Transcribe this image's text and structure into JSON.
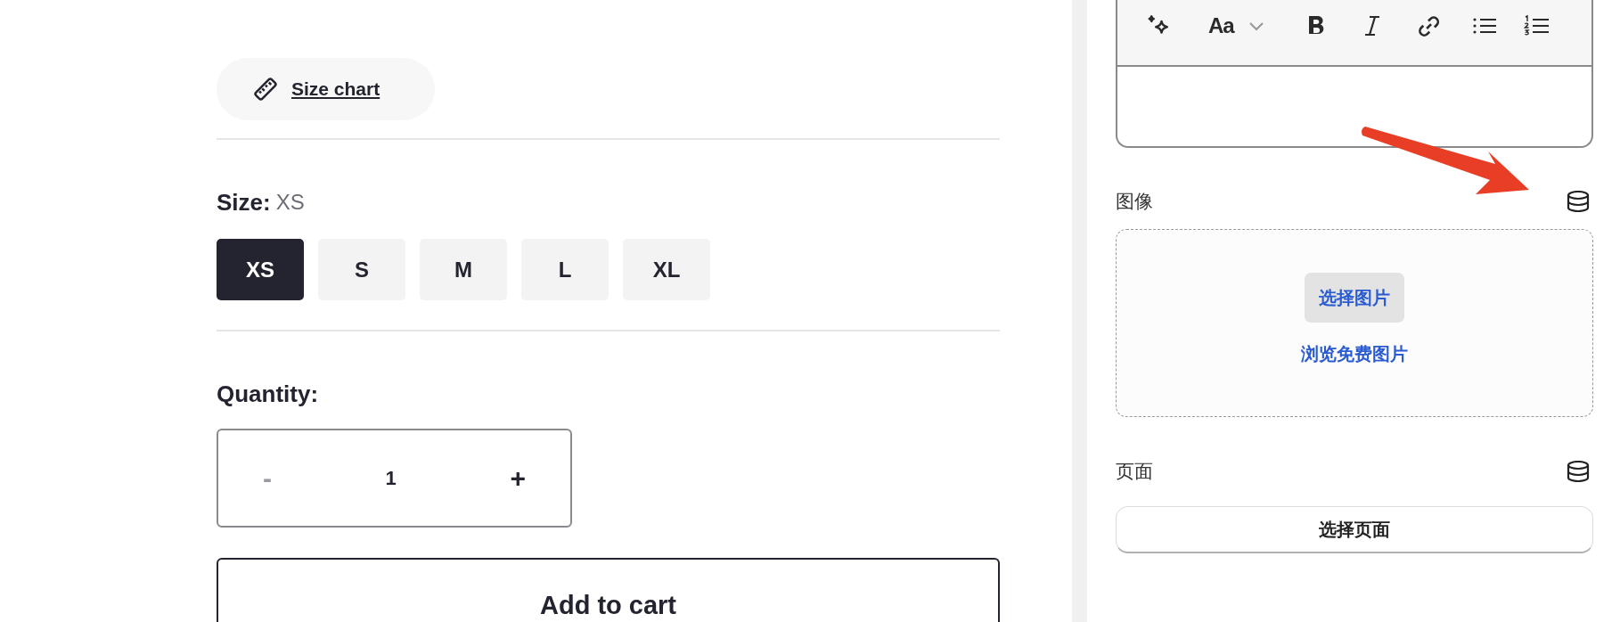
{
  "product": {
    "size_chart": "Size chart",
    "size_label": "Size:",
    "size_value": "XS",
    "sizes": [
      {
        "label": "XS",
        "selected": true
      },
      {
        "label": "S",
        "selected": false
      },
      {
        "label": "M",
        "selected": false
      },
      {
        "label": "L",
        "selected": false
      },
      {
        "label": "XL",
        "selected": false
      }
    ],
    "quantity_label": "Quantity:",
    "quantity": {
      "decrement": "-",
      "decrement_disabled": true,
      "value": "1",
      "increment": "+"
    },
    "add_to_cart": "Add to cart"
  },
  "editor": {
    "font_button": "Aa"
  },
  "image_setting": {
    "label": "图像",
    "choose_button": "选择图片",
    "browse_link": "浏览免费图片"
  },
  "page_setting": {
    "label": "页面",
    "choose_button": "选择页面"
  }
}
